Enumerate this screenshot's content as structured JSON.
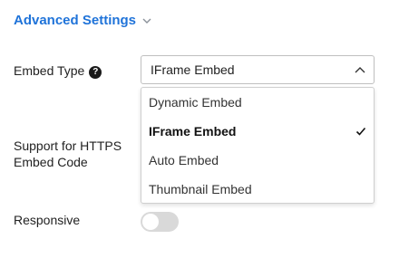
{
  "section": {
    "title": "Advanced Settings",
    "expand_icon": "chevron-down-icon"
  },
  "embed_type": {
    "label": "Embed Type",
    "help_glyph": "?",
    "selected": "IFrame Embed",
    "options": [
      {
        "label": "Dynamic Embed",
        "selected": false
      },
      {
        "label": "IFrame Embed",
        "selected": true
      },
      {
        "label": "Auto Embed",
        "selected": false
      },
      {
        "label": "Thumbnail Embed",
        "selected": false
      }
    ]
  },
  "https_embed": {
    "label": "Support for HTTPS Embed Code"
  },
  "responsive": {
    "label": "Responsive",
    "enabled": false
  },
  "colors": {
    "accent": "#1f73d9",
    "toggle_off": "#d9d9d9"
  }
}
